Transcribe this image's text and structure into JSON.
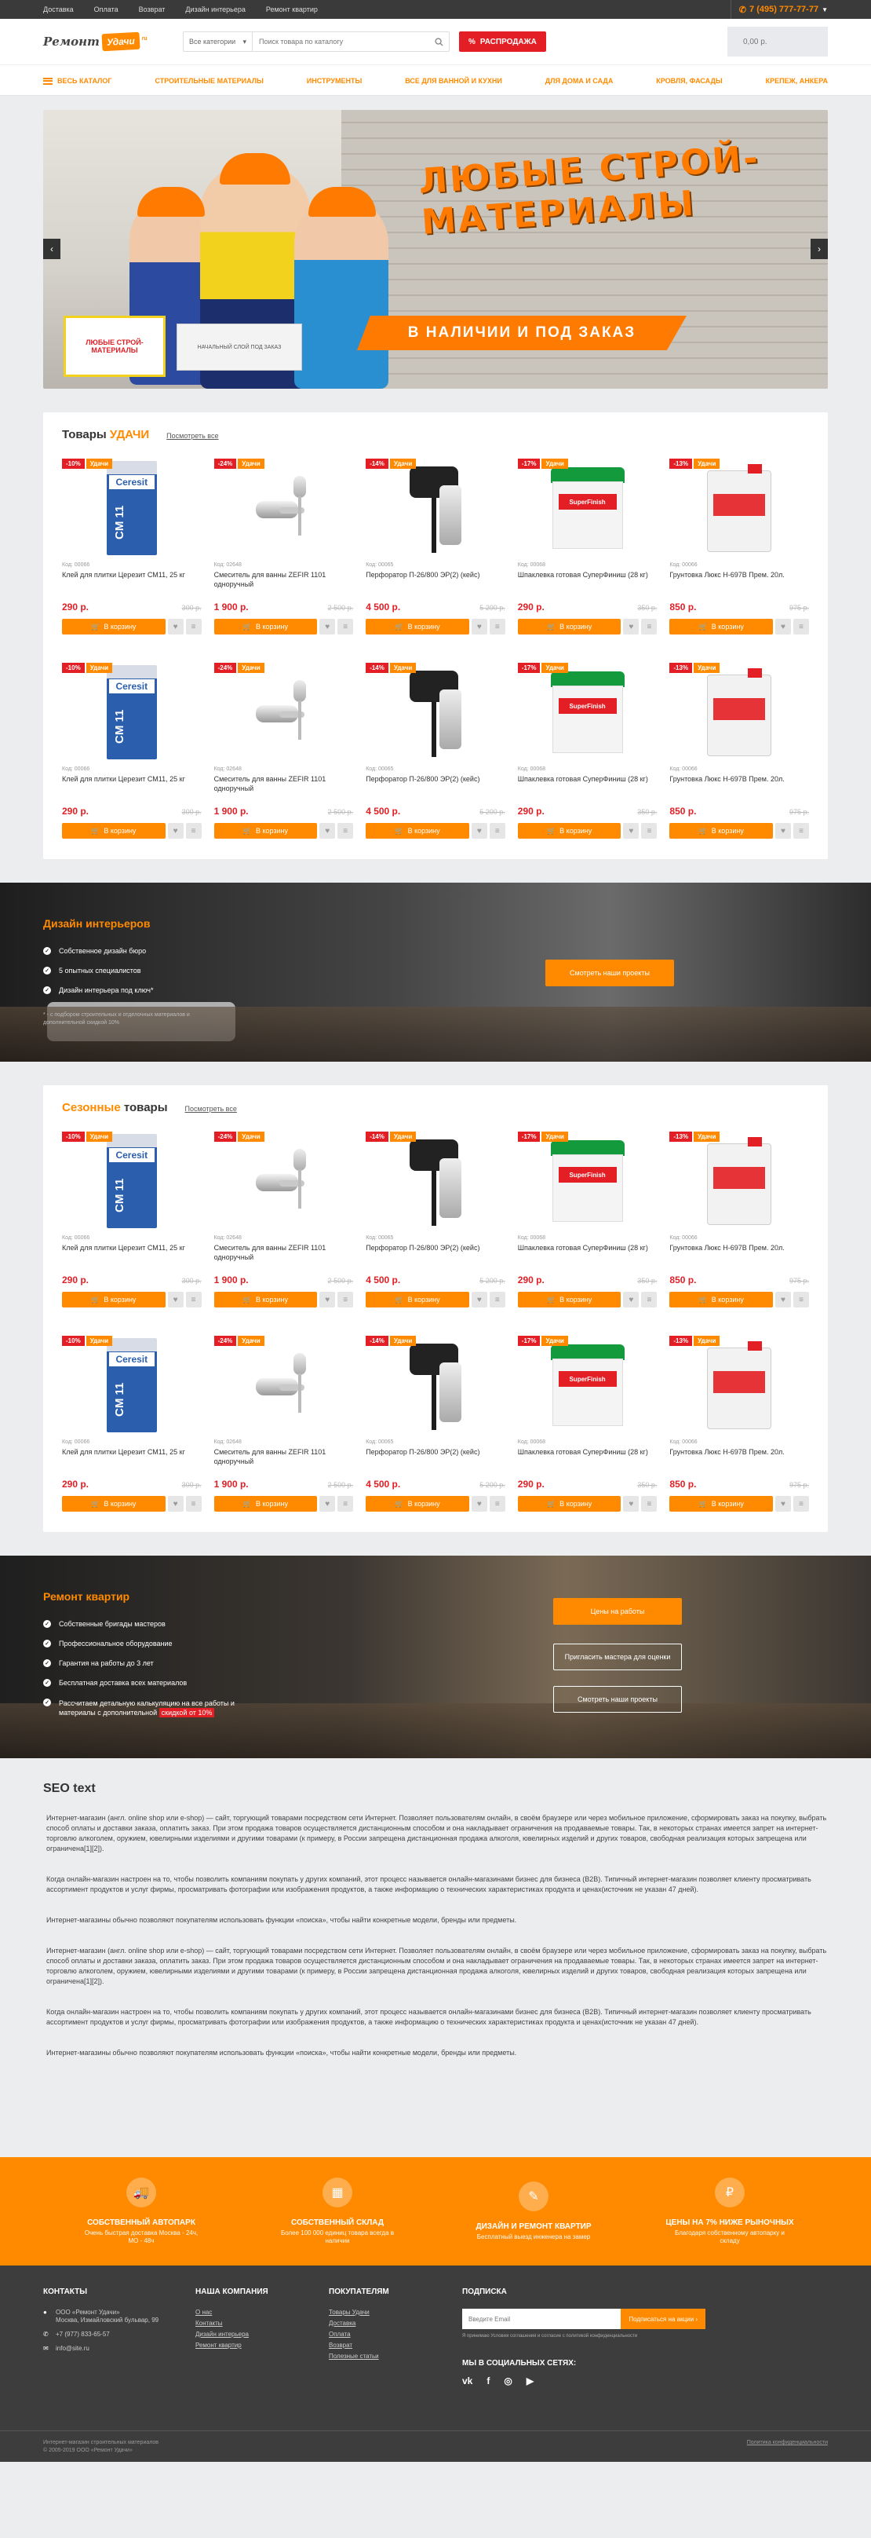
{
  "topbar": {
    "links": [
      "Доставка",
      "Оплата",
      "Возврат",
      "Дизайн интерьера",
      "Ремонт квартир"
    ],
    "phone": "7 (495) 777-77-77"
  },
  "header": {
    "logo_left": "Ремонт",
    "logo_mid": "Удачи",
    "logo_right": "ru",
    "search_category": "Все категории",
    "search_placeholder": "Поиск товара по каталогу",
    "sale_label": "РАСПРОДАЖА",
    "cart_total": "0,00 р."
  },
  "menu": [
    "ВЕСЬ КАТАЛОГ",
    "СТРОИТЕЛЬНЫЕ МАТЕРИАЛЫ",
    "ИНСТРУМЕНТЫ",
    "ВСЕ ДЛЯ ВАННОЙ И КУХНИ",
    "ДЛЯ ДОМА И САДА",
    "КРОВЛЯ, ФАСАДЫ",
    "КРЕПЕЖ, АНКЕРА"
  ],
  "banner": {
    "headline": "ЛЮБЫЕ СТРОЙ-МАТЕРИАЛЫ",
    "ribbon": "В НАЛИЧИИ И ПОД ЗАКАЗ",
    "ad_text": "ЛЮБЫЕ СТРОЙ-МАТЕРИАЛЫ",
    "ad2_text": "НАЧАЛЬНЫЙ СЛОЙ ПОД ЗАКАЗ"
  },
  "products": [
    {
      "discount": "-10%",
      "tag": "Удачи",
      "code": "Код: 00066",
      "name": "Клей для плитки Церезит СМ11, 25 кг",
      "price": "290 р.",
      "old": "300 р.",
      "img": "glue"
    },
    {
      "discount": "-24%",
      "tag": "Удачи",
      "code": "Код: 02648",
      "name": "Смеситель для ванны ZEFIR 1101 одноручный",
      "price": "1 900 р.",
      "old": "2 500 р.",
      "img": "mixer"
    },
    {
      "discount": "-14%",
      "tag": "Удачи",
      "code": "Код: 00065",
      "name": "Перфоратор П-26/800 ЭР(2) (кейс)",
      "price": "4 500 р.",
      "old": "5 200 р.",
      "img": "drill"
    },
    {
      "discount": "-17%",
      "tag": "Удачи",
      "code": "Код: 00068",
      "name": "Шпаклевка готовая СуперФиниш (28 кг)",
      "price": "290 р.",
      "old": "350 р.",
      "img": "bucket"
    },
    {
      "discount": "-13%",
      "tag": "Удачи",
      "code": "Код: 00066",
      "name": "Грунтовка Люкс Н-697В Прем. 20л.",
      "price": "850 р.",
      "old": "975 р.",
      "img": "can"
    }
  ],
  "block1": {
    "title_pre": "Товары ",
    "title_acc": "УДАЧИ",
    "all": "Посмотреть все",
    "buy": "В корзину"
  },
  "block2": {
    "title_acc": "Сезонные",
    "title_post": " товары",
    "all": "Посмотреть все",
    "buy": "В корзину"
  },
  "promo1": {
    "title": "Дизайн интерьеров",
    "items": [
      "Собственное дизайн бюро",
      "5 опытных специалистов",
      "Дизайн интерьера под ключ*"
    ],
    "note": "* - с подбором строительных и отделочных материалов и дополнительной скидкой 10%",
    "btn": "Смотреть наши проекты"
  },
  "promo2": {
    "title": "Ремонт квартир",
    "items": [
      "Собственные бригады мастеров",
      "Профессиональное оборудование",
      "Гарантия на работы до 3 лет",
      "Бесплатная доставка всех материалов",
      "Рассчитаем детальную калькуляцию на все работы и материалы с дополнительной"
    ],
    "highlight": "скидкой от 10%",
    "btn1": "Цены на работы",
    "btn2": "Пригласить мастера для оценки",
    "btn3": "Смотреть наши проекты"
  },
  "seo": {
    "title": "SEO text",
    "paragraphs": [
      "Интернет-магазин (англ. online shop или e-shop) — сайт, торгующий товарами посредством сети Интернет. Позволяет пользователям онлайн, в своём браузере или через мобильное приложение, сформировать заказ на покупку, выбрать способ оплаты и доставки заказа, оплатить заказ. При этом продажа товаров осуществляется дистанционным способом и она накладывает ограничения на продаваемые товары. Так, в некоторых странах имеется запрет на интернет-торговлю алкоголем, оружием, ювелирными изделиями и другими товарами (к примеру, в России запрещена дистанционная продажа алкоголя, ювелирных изделий и других товаров, свободная реализация которых запрещена или ограничена[1][2]).",
      "Когда онлайн-магазин настроен на то, чтобы позволить компаниям покупать у других компаний, этот процесс называется онлайн-магазинами бизнес для бизнеса (B2B). Типичный интернет-магазин позволяет клиенту просматривать ассортимент продуктов и услуг фирмы, просматривать фотографии или изображения продуктов, а также информацию о технических характеристиках продукта и ценах(источник не указан 47 дней).",
      "Интернет-магазины обычно позволяют покупателям использовать функции «поиска», чтобы найти конкретные модели, бренды или предметы.",
      "Интернет-магазин (англ. online shop или e-shop) — сайт, торгующий товарами посредством сети Интернет. Позволяет пользователям онлайн, в своём браузере или через мобильное приложение, сформировать заказ на покупку, выбрать способ оплаты и доставки заказа, оплатить заказ. При этом продажа товаров осуществляется дистанционным способом и она накладывает ограничения на продаваемые товары. Так, в некоторых странах имеется запрет на интернет-торговлю алкоголем, оружием, ювелирными изделиями и другими товарами (к примеру, в России запрещена дистанционная продажа алкоголя, ювелирных изделий и других товаров, свободная реализация которых запрещена или ограничена[1][2]).",
      "Когда онлайн-магазин настроен на то, чтобы позволить компаниям покупать у других компаний, этот процесс называется онлайн-магазинами бизнес для бизнеса (B2B). Типичный интернет-магазин позволяет клиенту просматривать ассортимент продуктов и услуг фирмы, просматривать фотографии или изображения продуктов, а также информацию о технических характеристиках продукта и ценах(источник не указан 47 дней).",
      "Интернет-магазины обычно позволяют покупателям использовать функции «поиска», чтобы найти конкретные модели, бренды или предметы."
    ]
  },
  "features": [
    {
      "icon": "truck-icon",
      "glyph": "🚚",
      "title": "СОБСТВЕННЫЙ АВТОПАРК",
      "sub": "Очень быстрая доставка Москва - 24ч, МО - 48ч"
    },
    {
      "icon": "warehouse-icon",
      "glyph": "▦",
      "title": "СОБСТВЕННЫЙ СКЛАД",
      "sub": "Более 100 000 единиц товара всегда в наличии"
    },
    {
      "icon": "roller-icon",
      "glyph": "✎",
      "title": "ДИЗАЙН И РЕМОНТ КВАРТИР",
      "sub": "Бесплатный выезд инженера на замер"
    },
    {
      "icon": "piggy-icon",
      "glyph": "₽",
      "title": "ЦЕНЫ НА 7% НИЖЕ РЫНОЧНЫХ",
      "sub": "Благодаря собственному автопарку и складу"
    }
  ],
  "footer": {
    "contacts_title": "КОНТАКТЫ",
    "company": "ООО «Ремонт Удачи»",
    "address": "Москва, Измайловский бульвар, 99",
    "phone": "+7 (977) 833-65-57",
    "email": "info@site.ru",
    "company_title": "НАША КОМПАНИЯ",
    "company_links": [
      "О нас",
      "Контакты",
      "Дизайн интерьера",
      "Ремонт квартир"
    ],
    "buyers_title": "ПОКУПАТЕЛЯМ",
    "buyer_links": [
      "Товары Удачи",
      "Доставка",
      "Оплата",
      "Возврат",
      "Полезные статьи"
    ],
    "sub_title": "ПОДПИСКА",
    "sub_placeholder": "Введите Email",
    "sub_btn": "Подписаться на акции",
    "agree": "Я принимаю Условия соглашения и согласие с политикой конфиденциальности",
    "social_title": "МЫ В СОЦИАЛЬНЫХ СЕТЯХ:",
    "social": [
      "vk",
      "f",
      "◎",
      "▶"
    ],
    "copy1": "Интернет-магазин строительных материалов",
    "copy2": "© 2005-2019 ООО «Ремонт Удачи»",
    "policy": "Политика конфиденциальности"
  }
}
